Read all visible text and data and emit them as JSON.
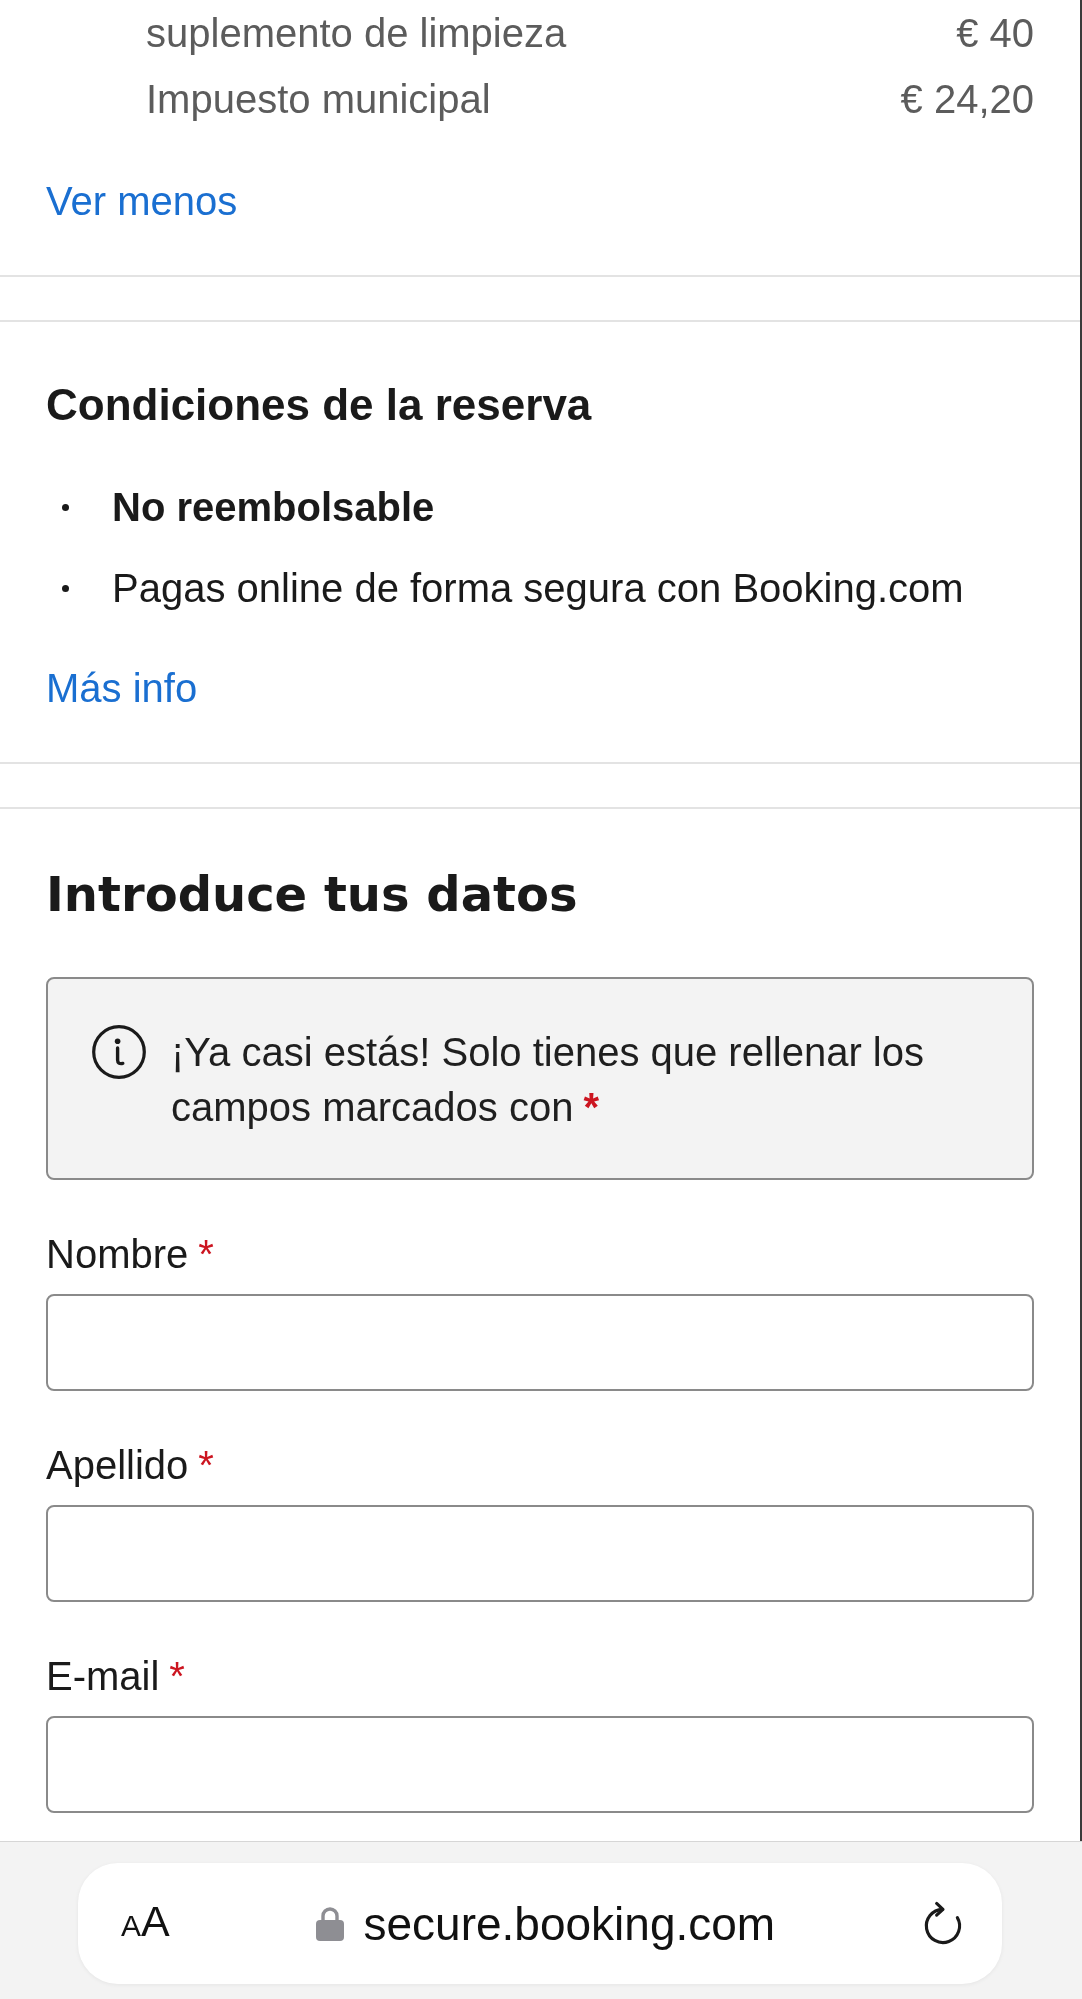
{
  "price_breakdown": {
    "rows": [
      {
        "label": "suplemento de limpieza",
        "amount": "€ 40"
      },
      {
        "label": "Impuesto municipal",
        "amount": "€ 24,20"
      }
    ],
    "toggle_link": "Ver menos"
  },
  "booking_conditions": {
    "title": "Condiciones de la reserva",
    "items": [
      {
        "text": "No reembolsable",
        "bold": true
      },
      {
        "text": "Pagas online de forma segura con Booking.com",
        "bold": false
      }
    ],
    "link": "Más info"
  },
  "details_form": {
    "title": "Introduce tus datos",
    "notice": {
      "text": "¡Ya casi estás! Solo tienes que rellenar los campos marcados con",
      "required_mark": "*"
    },
    "fields": [
      {
        "label": "Nombre",
        "required_mark": "*"
      },
      {
        "label": "Apellido",
        "required_mark": "*"
      },
      {
        "label": "E-mail",
        "required_mark": "*"
      }
    ]
  },
  "browser_bar": {
    "text_size_button": "AA",
    "url": "secure.booking.com"
  }
}
